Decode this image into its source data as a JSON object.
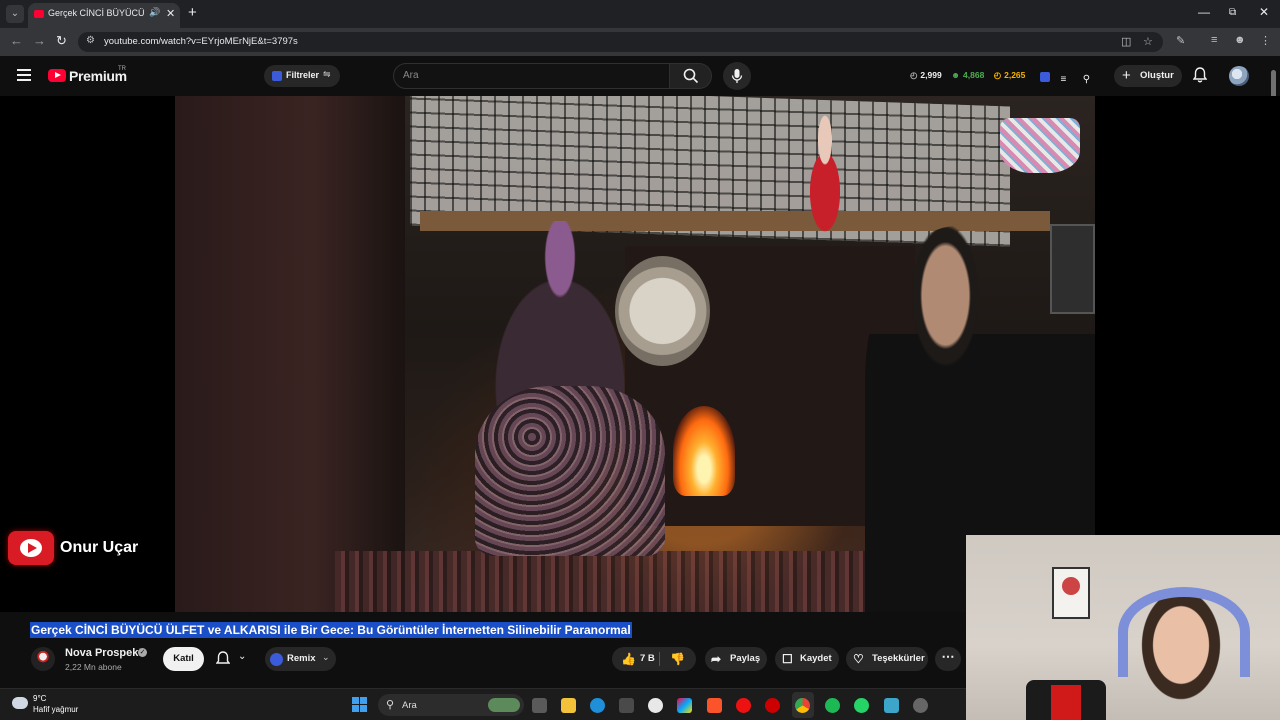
{
  "browser": {
    "tab_title": "Gerçek CİNCİ BÜYÜCÜ ÜLFET ve ALKARISI ile Bir Gece: Bu Görüntüler İnternetten Silinebilir Paranormal",
    "url": "youtube.com/watch?v=EYrjoMErNjE&t=3797s"
  },
  "masthead": {
    "logo_text": "Premium",
    "country_code": "TR",
    "filters_label": "Filtreler",
    "search_placeholder": "Ara",
    "stats": {
      "views": "2,999",
      "likes": "4,868",
      "time": "2,265"
    },
    "create_label": "Oluştur"
  },
  "video": {
    "watermark_name": "Onur Uçar",
    "title": "Gerçek CİNCİ BÜYÜCÜ ÜLFET ve ALKARISI ile Bir Gece: Bu Görüntüler İnternetten Silinebilir Paranormal"
  },
  "channel": {
    "name": "Nova Prospekt",
    "subscribers": "2,22 Mn abone",
    "join_label": "Katıl",
    "remix_label": "Remix"
  },
  "actions": {
    "like_count": "7 B",
    "share_label": "Paylaş",
    "save_label": "Kaydet",
    "thanks_label": "Teşekkürler"
  },
  "taskbar": {
    "temperature": "9°C",
    "weather_desc": "Hafif yağmur",
    "search_label": "Ara"
  },
  "colors": {
    "youtube_red": "#ff0033",
    "title_highlight": "#1a4fc7",
    "background": "#0f0f0f"
  }
}
